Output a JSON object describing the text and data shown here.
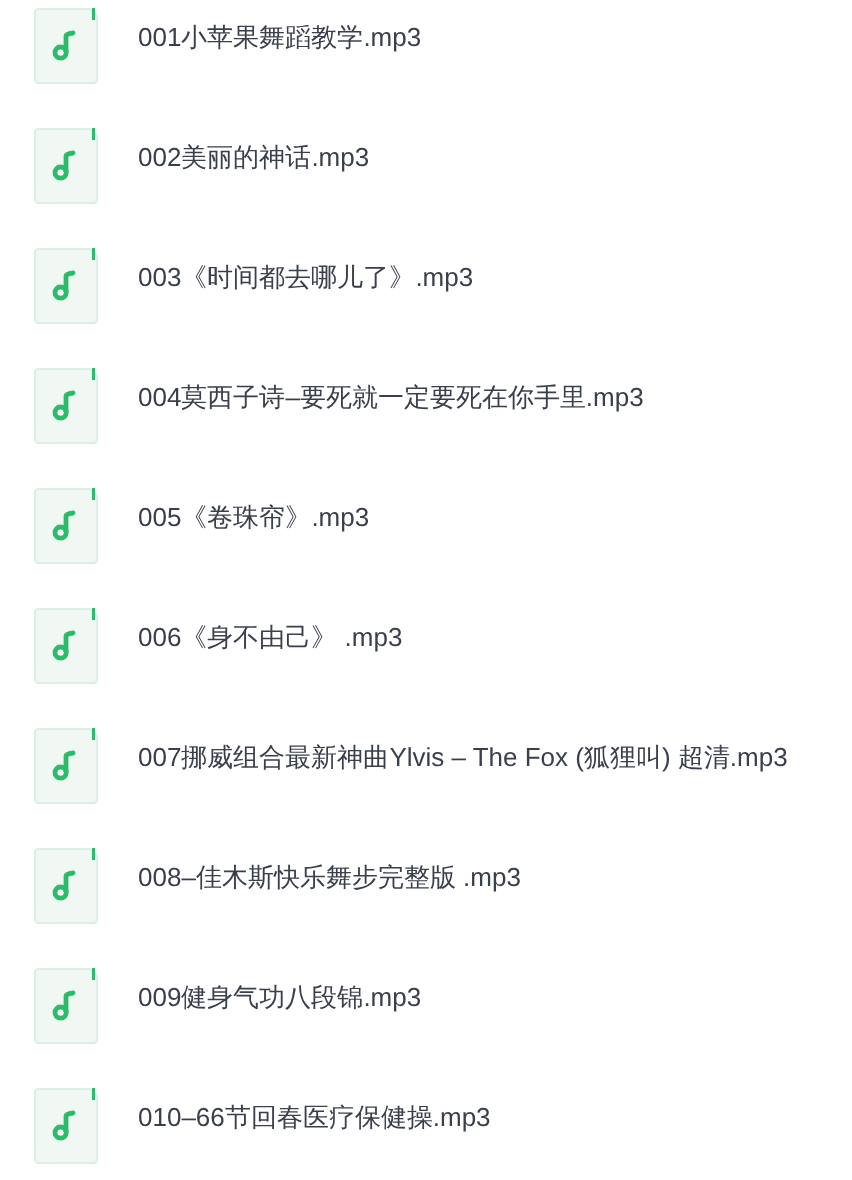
{
  "files": [
    {
      "name": "001小苹果舞蹈教学.mp3"
    },
    {
      "name": "002美丽的神话.mp3"
    },
    {
      "name": "003《时间都去哪儿了》.mp3"
    },
    {
      "name": "004莫西子诗–要死就一定要死在你手里.mp3"
    },
    {
      "name": "005《卷珠帘》.mp3"
    },
    {
      "name": "006《身不由己》 .mp3"
    },
    {
      "name": "007挪威组合最新神曲Ylvis – The Fox (狐狸叫) 超清.mp3"
    },
    {
      "name": "008–佳木斯快乐舞步完整版 .mp3"
    },
    {
      "name": "009健身气功八段锦.mp3"
    },
    {
      "name": "010–66节回春医疗保健操.mp3"
    }
  ]
}
